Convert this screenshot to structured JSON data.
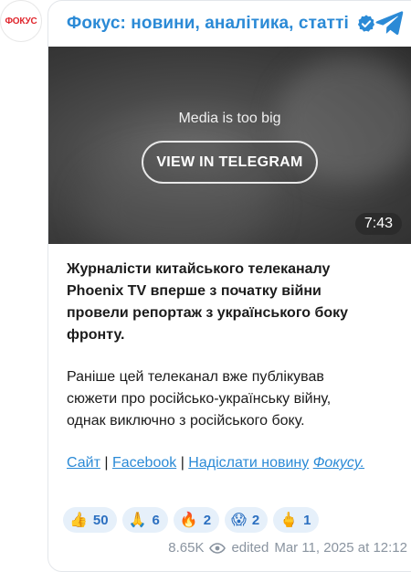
{
  "channel": {
    "avatar_text": "ФОКУС",
    "title": "Фокус: новини, аналітика, статті"
  },
  "media": {
    "note": "Media is too big",
    "button_label": "VIEW IN TELEGRAM",
    "duration": "7:43"
  },
  "post": {
    "lead": "Журналісти китайського телеканалу Phoenix TV вперше з початку війни провели репортаж з українського боку фронту.",
    "body": "Раніше цей телеканал вже публікував сюжети про російсько-українську війну, однак виключно з російського боку.",
    "links": {
      "site": "Сайт",
      "facebook": "Facebook",
      "submit": "Надіслати новину",
      "brand": "Фокусу."
    }
  },
  "reactions": [
    {
      "emoji": "👍",
      "count": "50"
    },
    {
      "emoji": "🙏",
      "count": "6"
    },
    {
      "emoji": "🔥",
      "count": "2"
    },
    {
      "emoji": "😱",
      "count": "2"
    },
    {
      "emoji": "🖕",
      "count": "1"
    }
  ],
  "meta": {
    "views": "8.65K",
    "edited_label": "edited",
    "date": "Mar 11, 2025 at 12:12"
  },
  "colors": {
    "accent": "#2b8ad6",
    "brand_red": "#e0262d",
    "reaction_bg": "#e6f0fa"
  }
}
